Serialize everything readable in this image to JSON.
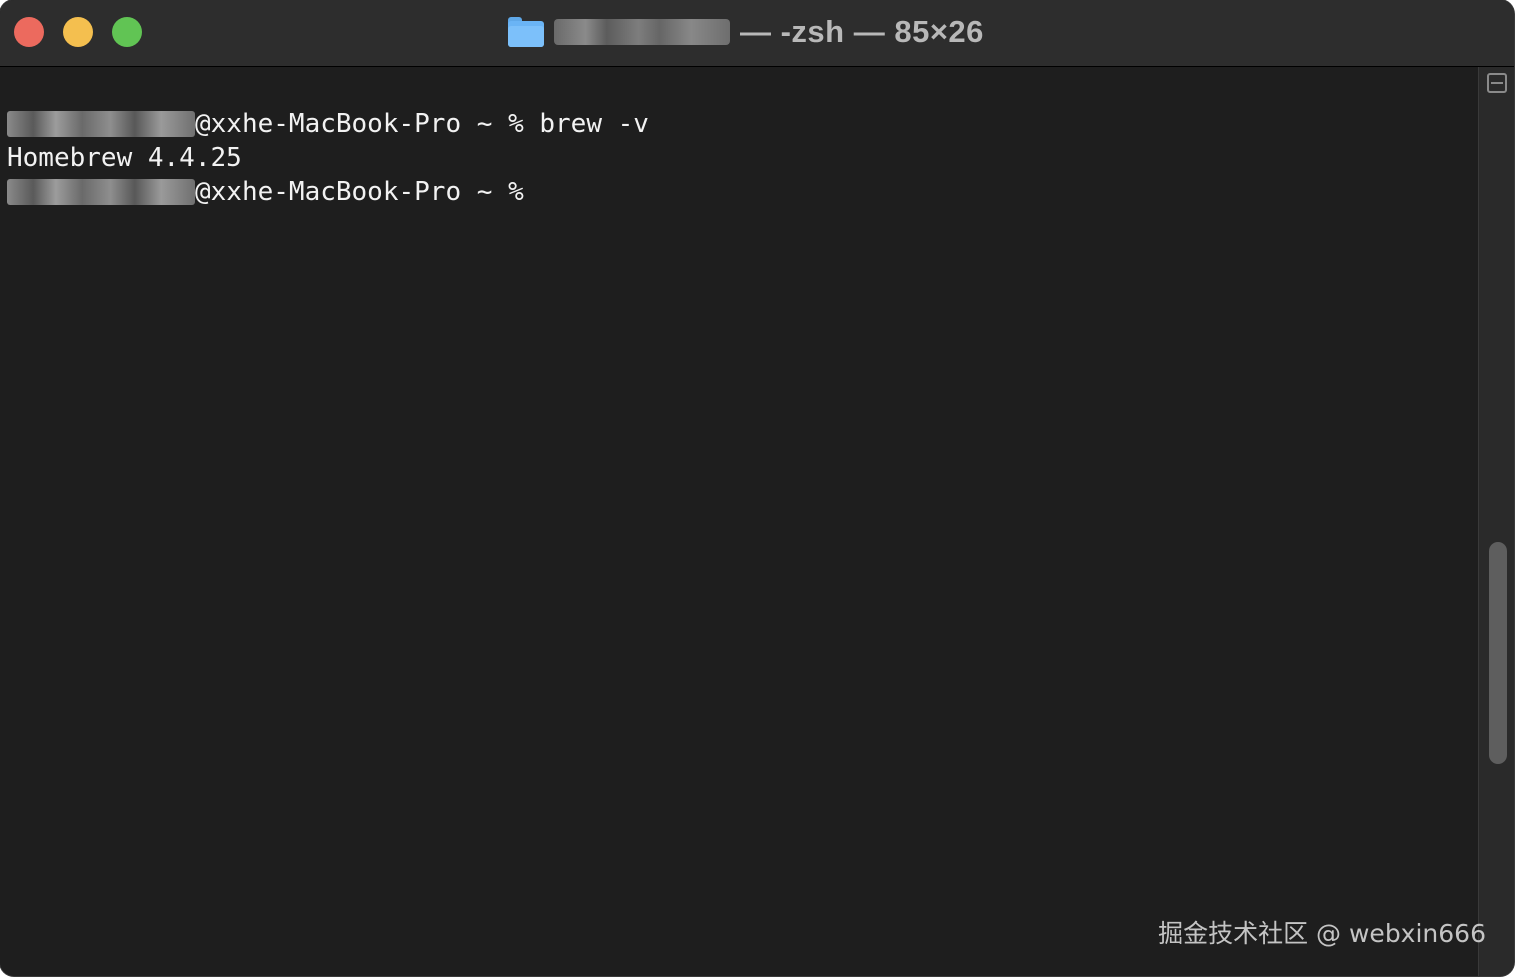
{
  "window": {
    "title_suffix": "— -zsh — 85×26",
    "folder_icon": "folder-icon"
  },
  "terminal": {
    "lines": [
      {
        "host_prompt": "@xxhe-MacBook-Pro ~ % ",
        "command": "brew -v"
      },
      {
        "output": "Homebrew 4.4.25"
      },
      {
        "host_prompt": "@xxhe-MacBook-Pro ~ % ",
        "command": ""
      }
    ]
  },
  "colors": {
    "close": "#ec6a5e",
    "minimize": "#f4bf4f",
    "maximize": "#61c454",
    "terminal_bg": "#1e1e1e",
    "text": "#f2f2f2"
  },
  "watermark": "掘金技术社区 @ webxin666"
}
